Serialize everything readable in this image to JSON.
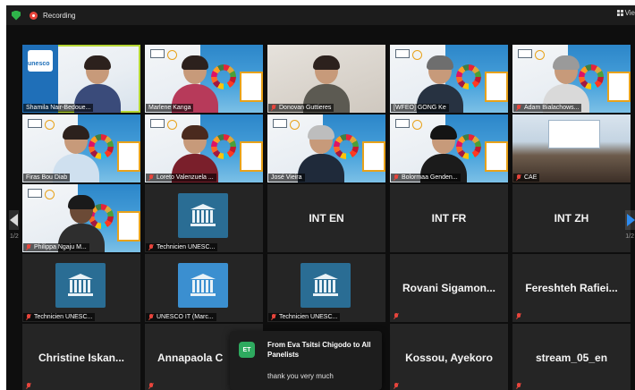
{
  "topbar": {
    "recording_label": "Recording",
    "view_label": "Vie"
  },
  "navigation": {
    "page_indicator_left": "1/2",
    "page_indicator_right": "1/2"
  },
  "participants": {
    "row1": [
      {
        "name": "Shamila Nair-Bedoue...",
        "muted": false,
        "active_speaker": true
      },
      {
        "name": "Marlene Kanga",
        "muted": false
      },
      {
        "name": "Donovan Guttieres",
        "muted": true
      },
      {
        "name": "[WFEO] GONG Ke",
        "muted": false
      },
      {
        "name": "Adam Bialachows...",
        "muted": true
      }
    ],
    "row2": [
      {
        "name": "Firas Bou Diab",
        "muted": false
      },
      {
        "name": "Loreto Valenzuela ...",
        "muted": true
      },
      {
        "name": "José Vieira",
        "muted": false
      },
      {
        "name": "Bolormaa Genden...",
        "muted": true
      },
      {
        "name": "CAE",
        "muted": true
      }
    ],
    "row3": [
      {
        "name": "Philippa Ngaju M...",
        "muted": true
      },
      {
        "name": "Technicien UNESC...",
        "muted": true
      },
      {
        "name": "INT EN",
        "muted": false
      },
      {
        "name": "INT FR",
        "muted": false
      },
      {
        "name": "INT ZH",
        "muted": false
      }
    ],
    "row4": [
      {
        "name": "Technicien UNESC...",
        "muted": true
      },
      {
        "name": "UNESCO IT (Marc...",
        "muted": true
      },
      {
        "name": "Technicien UNESC...",
        "muted": true
      },
      {
        "name": "Rovani Sigamon...",
        "muted": true
      },
      {
        "name": "Fereshteh Rafiei...",
        "muted": true
      }
    ],
    "row5": [
      {
        "name": "Christine Iskan...",
        "muted": true
      },
      {
        "name": "Annapaola C",
        "muted": true
      },
      {
        "name": "Kossou, Ayekoro",
        "muted": true
      },
      {
        "name": "stream_05_en",
        "muted": true
      }
    ]
  },
  "unesco_logo_text": "unesco",
  "chat": {
    "avatar_initials": "ET",
    "from": "From Eva Tsitsi Chigodo to All Panelists",
    "message": "thank you very much"
  },
  "colors": {
    "active_speaker_border": "#b5d633",
    "muted_mic": "#e8453c",
    "chat_avatar": "#2eaa5f",
    "next_page_arrow": "#2d8cf0"
  }
}
